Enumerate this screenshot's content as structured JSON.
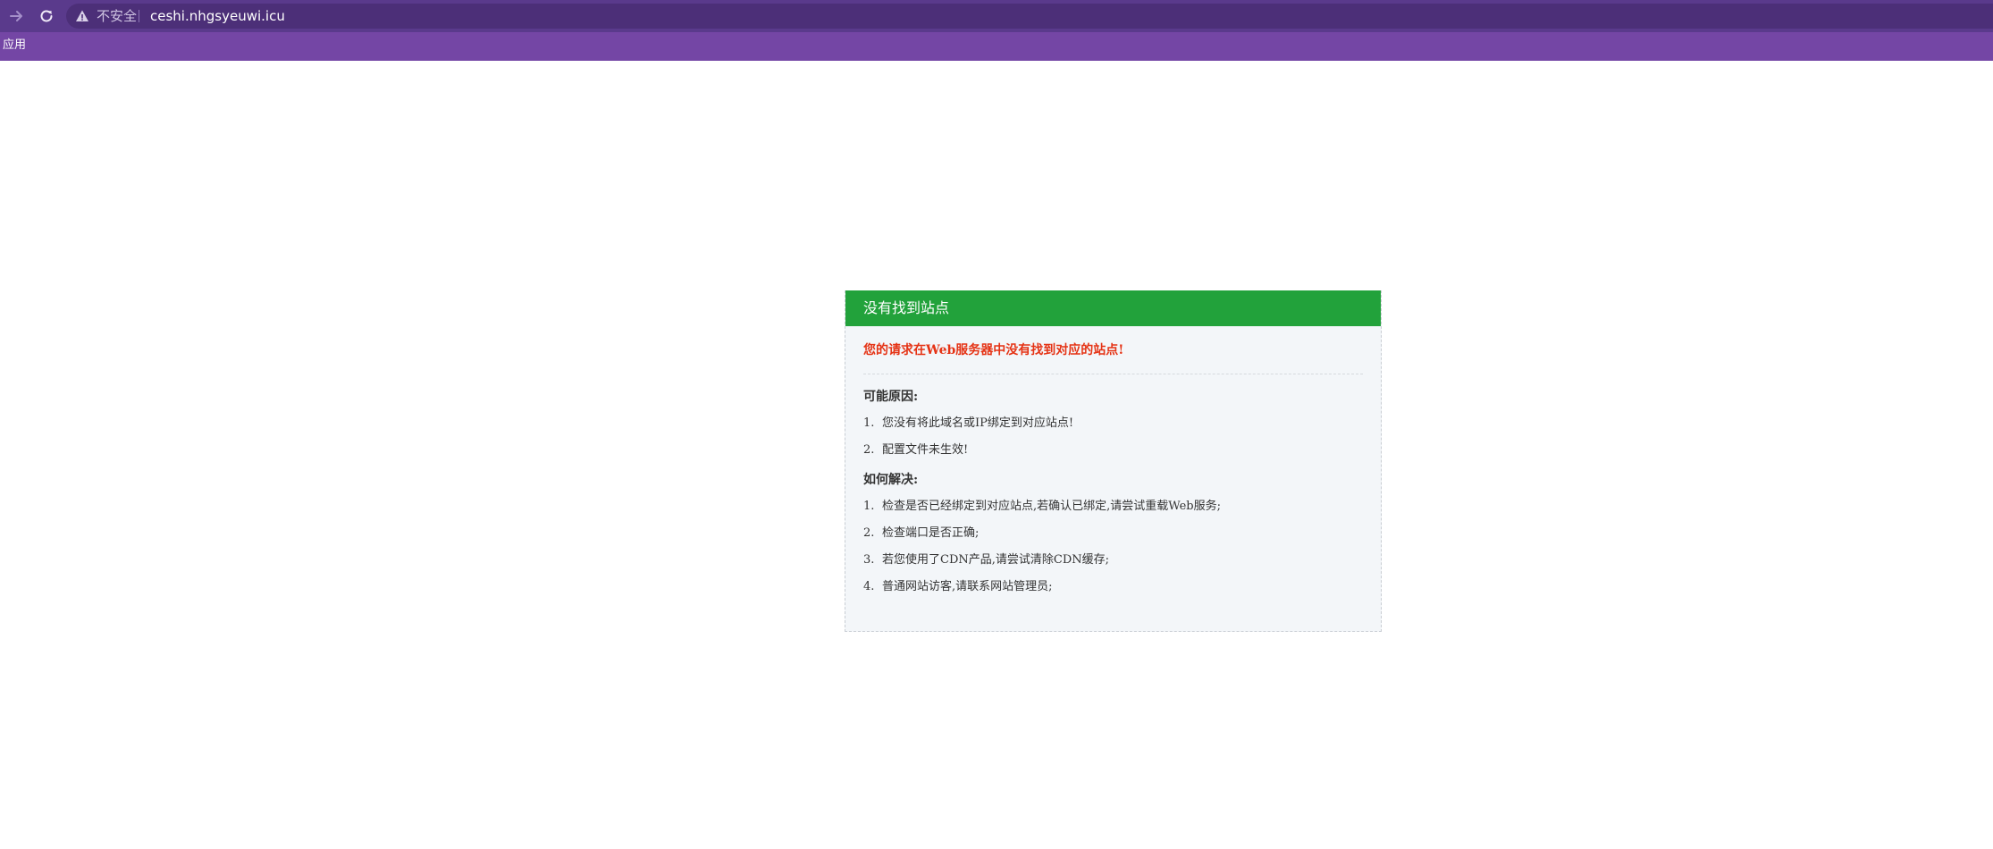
{
  "browser": {
    "security_label": "不安全",
    "url": "ceshi.nhgsyeuwi.icu",
    "bookmarks": [
      "应用"
    ]
  },
  "error_card": {
    "title": "没有找到站点",
    "alert": "您的请求在Web服务器中没有找到对应的站点!",
    "reasons_title": "可能原因:",
    "reasons": [
      {
        "num": "1.",
        "text": "您没有将此域名或IP绑定到对应站点!"
      },
      {
        "num": "2.",
        "text": "配置文件未生效!"
      }
    ],
    "solutions_title": "如何解决:",
    "solutions": [
      {
        "num": "1.",
        "text": "检查是否已经绑定到对应站点,若确认已绑定,请尝试重载Web服务;"
      },
      {
        "num": "2.",
        "text": "检查端口是否正确;"
      },
      {
        "num": "3.",
        "text": "若您使用了CDN产品,请尝试清除CDN缓存;"
      },
      {
        "num": "4.",
        "text": "普通网站访客,请联系网站管理员;"
      }
    ]
  },
  "colors": {
    "toolbar": "#5a3a8c",
    "bookmarks_bar": "#7446a5",
    "card_header": "#22a23b",
    "alert_text": "#e53315",
    "card_bg": "#f3f6f9"
  },
  "icons": {
    "forward": "arrow-right-icon",
    "reload": "reload-icon",
    "security": "warning-triangle-icon"
  }
}
